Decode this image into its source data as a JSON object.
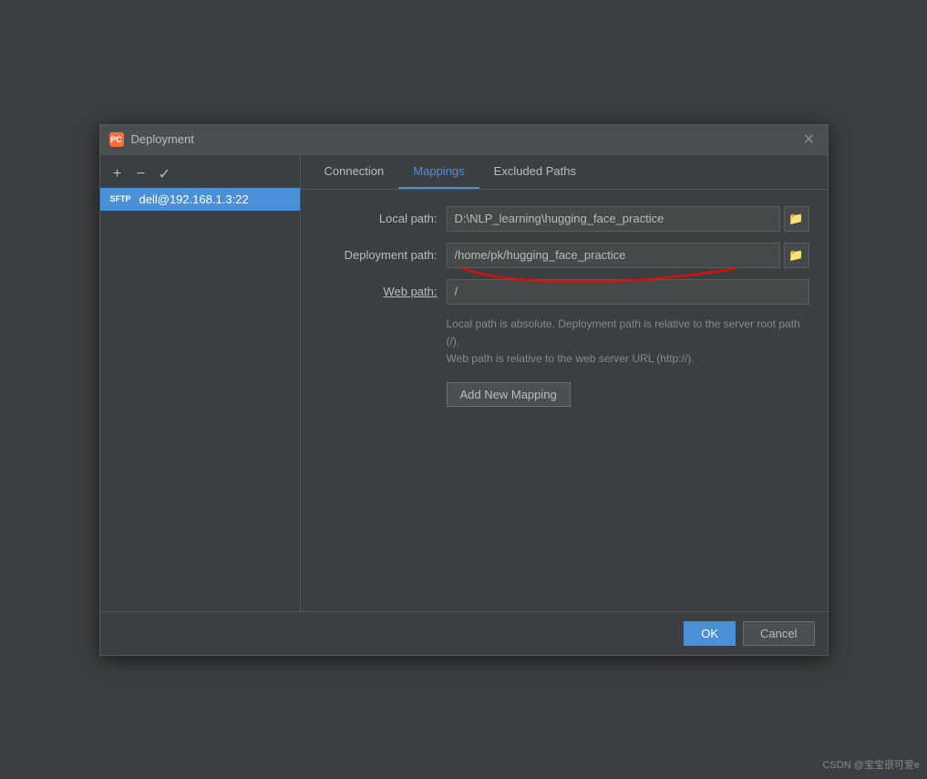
{
  "dialog": {
    "title": "Deployment",
    "app_icon_label": "PC"
  },
  "sidebar": {
    "toolbar": {
      "add_label": "+",
      "remove_label": "−",
      "confirm_label": "✓"
    },
    "items": [
      {
        "label": "dell@192.168.1.3:22",
        "badge": "SFTP",
        "active": true
      }
    ]
  },
  "tabs": [
    {
      "id": "connection",
      "label": "Connection",
      "active": false
    },
    {
      "id": "mappings",
      "label": "Mappings",
      "active": true
    },
    {
      "id": "excluded-paths",
      "label": "Excluded Paths",
      "active": false
    }
  ],
  "form": {
    "local_path_label": "Local path:",
    "local_path_value": "D:\\NLP_learning\\hugging_face_practice",
    "deployment_path_label": "Deployment path:",
    "deployment_path_value": "/home/pk/hugging_face_practice",
    "web_path_label": "Web path:",
    "web_path_value": "/",
    "hint_line1": "Local path is absolute. Deployment path is relative to the server root path (/).",
    "hint_line2": "Web path is relative to the web server URL (http://).",
    "add_mapping_btn": "Add New Mapping"
  },
  "footer": {
    "ok_label": "OK",
    "cancel_label": "Cancel"
  },
  "watermark": "CSDN @宝宝很可爱e"
}
